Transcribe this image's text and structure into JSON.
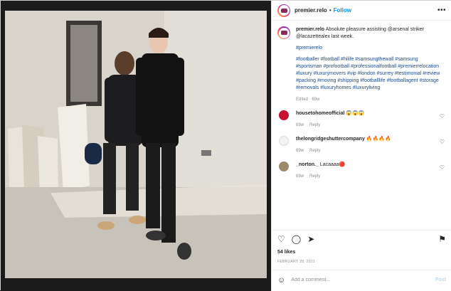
{
  "post": {
    "username": "premier.relo",
    "follow_label": "Follow",
    "more_label": "•••",
    "caption_user": "premier.relo",
    "caption_text": "Absolute pleasure assisting @arsenal striker @lacazettealex last week.",
    "hashtag_1": "#premierelo",
    "hashtags": "#footballer #football #hilife #samsungthewall #samsung #sportsman #profootball #professionalfootball #premierrelocation #luxury #luxurymovers #vip #london #surrey #testimonial #review #packing #moving #shipping #footballlife #footballagent #storage #removals #luxuryhomes #luxuryliving",
    "edited": "Edited · 69w",
    "likes": "54 likes",
    "date": "FEBRUARY 28, 2021",
    "comment_placeholder": "Add a comment...",
    "post_label": "Post"
  },
  "comments": [
    {
      "user": "housetohomeofficial",
      "text": "😱😱😱",
      "age": "69w",
      "reply": "Reply",
      "avatar_color": "#c8102e"
    },
    {
      "user": "thelongridgeshuttercompany",
      "text": "🔥🔥🔥🔥",
      "age": "69w",
      "reply": "Reply",
      "avatar_color": "#f2f2f2"
    },
    {
      "user": "_norton._",
      "text": "Lacaaaa🔴",
      "age": "69w",
      "reply": "Reply",
      "avatar_color": "#9c8a6a"
    }
  ],
  "icons": {
    "like": "heart-icon",
    "comment": "comment-icon",
    "share": "share-icon",
    "save": "bookmark-icon",
    "emoji": "emoji-icon"
  },
  "colors": {
    "accent": "#0095f6",
    "muted": "#8e8e8e",
    "link": "#1e4a8a"
  }
}
